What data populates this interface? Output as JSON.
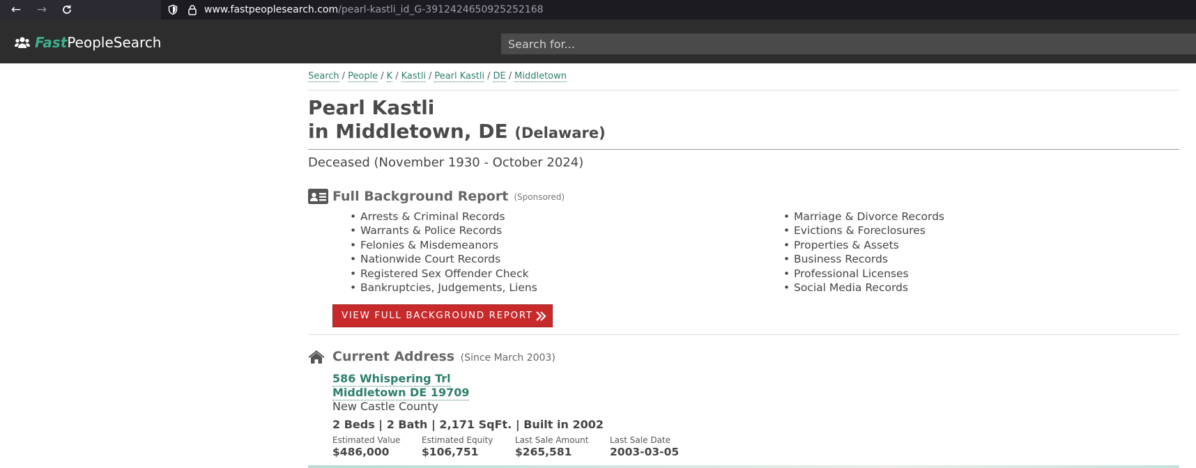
{
  "browser": {
    "url_host": "www.fastpeoplesearch.com",
    "url_path": "/pearl-kastli_id_G-3912424650925252168"
  },
  "site": {
    "logo_fast": "Fast",
    "logo_rest": "PeopleSearch",
    "search_placeholder": "Search for..."
  },
  "breadcrumb": [
    "Search",
    "People",
    "K",
    "Kastli",
    "Pearl Kastli",
    "DE",
    "Middletown"
  ],
  "person": {
    "name": "Pearl Kastli",
    "location": "in Middletown, DE",
    "state_full": "(Delaware)",
    "status": "Deceased (November 1930 - October 2024)"
  },
  "background_report": {
    "title": "Full Background Report",
    "sponsored": "(Sponsored)",
    "left_items": [
      "Arrests & Criminal Records",
      "Warrants & Police Records",
      "Felonies & Misdemeanors",
      "Nationwide Court Records",
      "Registered Sex Offender Check",
      "Bankruptcies, Judgements, Liens"
    ],
    "right_items": [
      "Marriage & Divorce Records",
      "Evictions & Foreclosures",
      "Properties & Assets",
      "Business Records",
      "Professional Licenses",
      "Social Media Records"
    ],
    "button_label": "VIEW FULL BACKGROUND REPORT"
  },
  "current_address": {
    "title": "Current Address",
    "since": "(Since March 2003)",
    "street": "586 Whispering Trl",
    "city_line": "Middletown DE 19709",
    "county": "New Castle County",
    "specs": "2 Beds | 2 Bath | 2,171 SqFt. | Built in 2002",
    "stats": [
      {
        "label": "Estimated Value",
        "value": "$486,000"
      },
      {
        "label": "Estimated Equity",
        "value": "$106,751"
      },
      {
        "label": "Last Sale Amount",
        "value": "$265,581"
      },
      {
        "label": "Last Sale Date",
        "value": "2003-03-05"
      }
    ]
  },
  "colors": {
    "accent_green": "#3fae8c",
    "link_green": "#2e7f6e",
    "button_red": "#c8292b",
    "header_bg": "#2d2d2d"
  }
}
